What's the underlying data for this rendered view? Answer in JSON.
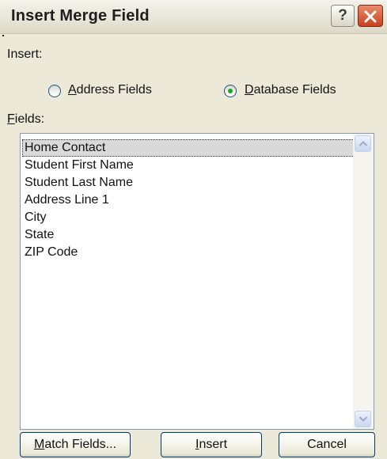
{
  "dialog": {
    "title": "Insert Merge Field",
    "help_glyph": "?"
  },
  "insert_group": {
    "label": "Insert:",
    "address_radio": {
      "mnemonic": "A",
      "rest": "ddress Fields",
      "selected": false
    },
    "database_radio": {
      "mnemonic": "D",
      "rest": "atabase Fields",
      "selected": true
    }
  },
  "fields": {
    "label_mnemonic": "F",
    "label_rest": "ields:",
    "items": [
      "Home Contact",
      "Student First Name",
      "Student Last Name",
      "Address Line 1",
      "City",
      "State",
      "ZIP Code"
    ],
    "selected_index": 0
  },
  "buttons": {
    "match_mnemonic": "M",
    "match_rest": "atch Fields...",
    "insert_mnemonic": "I",
    "insert_rest": "nsert",
    "cancel": "Cancel"
  },
  "icons": {
    "help": "help-icon",
    "close": "close-icon",
    "scroll_up": "chevron-up-icon",
    "scroll_down": "chevron-down-icon"
  }
}
